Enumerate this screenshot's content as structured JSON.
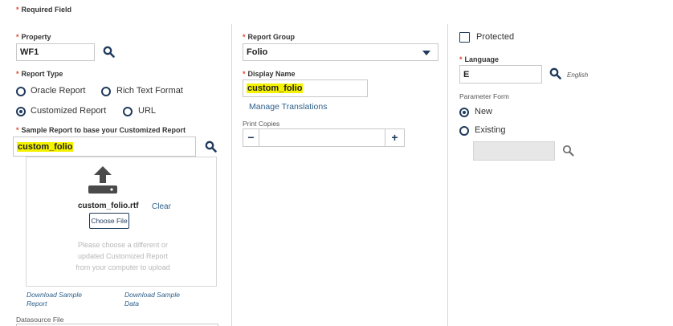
{
  "required_note": "Required Field",
  "left": {
    "property_label": "Property",
    "property_value": "WF1",
    "report_type_label": "Report Type",
    "report_types": [
      "Oracle Report",
      "Rich Text Format",
      "Customized Report",
      "URL"
    ],
    "sample_label": "Sample Report to base your Customized Report",
    "sample_value": "custom_folio",
    "file_name": "custom_folio.rtf",
    "clear_label": "Clear",
    "choose_file_label": "Choose File",
    "upload_help": [
      "Please choose a different or",
      "updated Customized Report",
      "from your computer to upload"
    ],
    "download_sample_report": [
      "Download Sample",
      "Report"
    ],
    "download_sample_data": [
      "Download Sample",
      "Data"
    ],
    "datasource_label": "Datasource File"
  },
  "middle": {
    "report_group_label": "Report Group",
    "report_group_value": "Folio",
    "display_name_label": "Display Name",
    "display_name_value": "custom_folio",
    "manage_translations": "Manage Translations",
    "print_copies_label": "Print Copies",
    "minus": "−",
    "plus": "+"
  },
  "right": {
    "protected_label": "Protected",
    "language_label": "Language",
    "language_value": "E",
    "language_name": "English",
    "parameter_form_label": "Parameter Form",
    "param_options": [
      "New",
      "Existing"
    ]
  },
  "colors": {
    "accent": "#1f3a5c",
    "highlight": "#f5f200",
    "required": "#e0442e",
    "link": "#2d5f8a"
  }
}
